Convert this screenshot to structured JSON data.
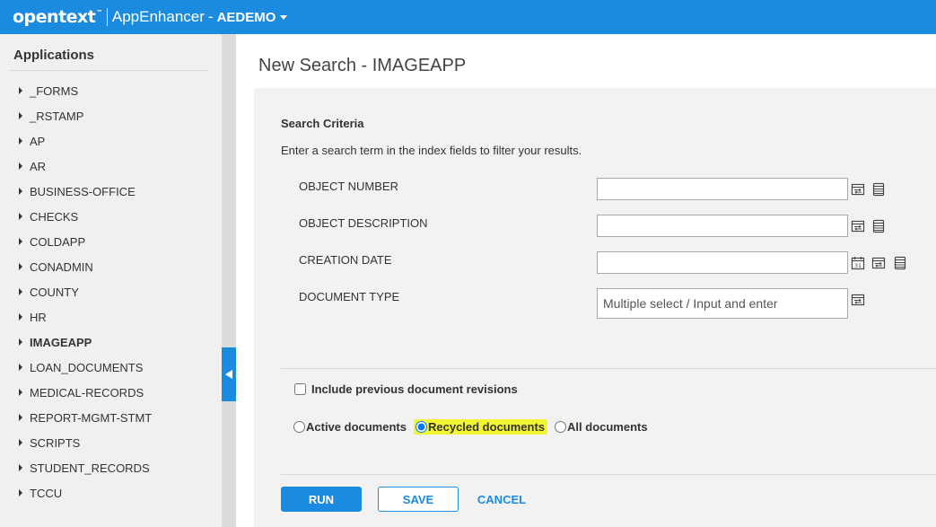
{
  "header": {
    "logo": "opentext",
    "logo_tm": "™",
    "app_name": "AppEnhancer",
    "dash": "-",
    "database": "AEDEMO"
  },
  "sidebar": {
    "title": "Applications",
    "items": [
      {
        "label": "_FORMS"
      },
      {
        "label": "_RSTAMP"
      },
      {
        "label": "AP"
      },
      {
        "label": "AR"
      },
      {
        "label": "BUSINESS-OFFICE"
      },
      {
        "label": "CHECKS"
      },
      {
        "label": "COLDAPP"
      },
      {
        "label": "CONADMIN"
      },
      {
        "label": "COUNTY"
      },
      {
        "label": "HR"
      },
      {
        "label": "IMAGEAPP",
        "active": true
      },
      {
        "label": "LOAN_DOCUMENTS"
      },
      {
        "label": "MEDICAL-RECORDS"
      },
      {
        "label": "REPORT-MGMT-STMT"
      },
      {
        "label": "SCRIPTS"
      },
      {
        "label": "STUDENT_RECORDS"
      },
      {
        "label": "TCCU"
      }
    ]
  },
  "main": {
    "title": "New Search - IMAGEAPP",
    "criteria_title": "Search Criteria",
    "criteria_hint": "Enter a search term in the index fields to filter your results.",
    "fields": [
      {
        "label": "OBJECT NUMBER",
        "value": "",
        "placeholder": ""
      },
      {
        "label": "OBJECT DESCRIPTION",
        "value": "",
        "placeholder": ""
      },
      {
        "label": "CREATION DATE",
        "value": "",
        "placeholder": ""
      },
      {
        "label": "DOCUMENT TYPE",
        "value": "",
        "placeholder": "Multiple select / Input and enter"
      }
    ],
    "include_revisions_label": "Include previous document revisions",
    "include_revisions_checked": false,
    "doc_filter": {
      "options": [
        "Active documents",
        "Recycled documents",
        "All documents"
      ],
      "selected": "Recycled documents"
    },
    "buttons": {
      "run": "RUN",
      "save": "SAVE",
      "cancel": "CANCEL"
    }
  },
  "colors": {
    "brand": "#1b8be0",
    "highlight": "#f2f531",
    "panel": "#f2f2f2",
    "sidebar": "#f0f0f0"
  },
  "icons": [
    "operator-icon",
    "list-icon",
    "calendar-icon",
    "collapse-arrow-icon"
  ]
}
